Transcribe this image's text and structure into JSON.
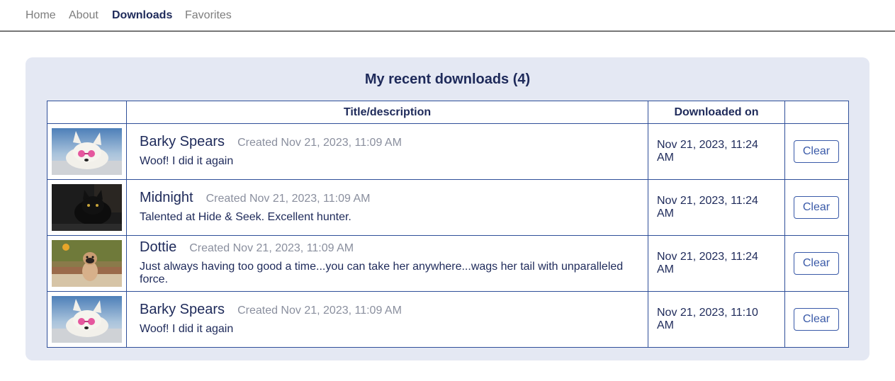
{
  "nav": {
    "items": [
      {
        "label": "Home"
      },
      {
        "label": "About"
      },
      {
        "label": "Downloads"
      },
      {
        "label": "Favorites"
      }
    ]
  },
  "page": {
    "heading": "My recent downloads (4)"
  },
  "table": {
    "headers": [
      "",
      "Title/description",
      "Downloaded on",
      ""
    ],
    "rows": [
      {
        "thumbnail": "dog-with-pink-sunglasses",
        "name": "Barky Spears",
        "created": "Created Nov 21, 2023, 11:09 AM",
        "description": "Woof! I did it again",
        "downloaded": "Nov 21, 2023, 11:24 AM",
        "action": "Clear"
      },
      {
        "thumbnail": "black-cat",
        "name": "Midnight",
        "created": "Created Nov 21, 2023, 11:09 AM",
        "description": "Talented at Hide & Seek. Excellent hunter.",
        "downloaded": "Nov 21, 2023, 11:24 AM",
        "action": "Clear"
      },
      {
        "thumbnail": "pug",
        "name": "Dottie",
        "created": "Created Nov 21, 2023, 11:09 AM",
        "description": "Just always having too good a time...you can take her anywhere...wags her tail with unparalleled force.",
        "downloaded": "Nov 21, 2023, 11:24 AM",
        "action": "Clear"
      },
      {
        "thumbnail": "dog-with-pink-sunglasses",
        "name": "Barky Spears",
        "created": "Created Nov 21, 2023, 11:09 AM",
        "description": "Woof! I did it again",
        "downloaded": "Nov 21, 2023, 11:10 AM",
        "action": "Clear"
      }
    ]
  }
}
